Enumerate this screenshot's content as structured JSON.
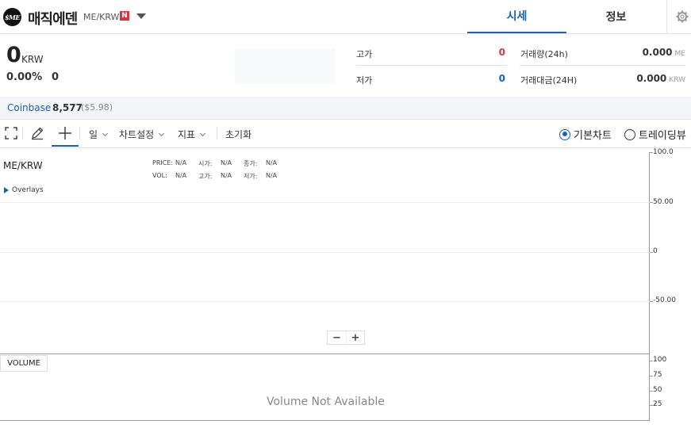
{
  "coin": {
    "logo_text": "$ME",
    "name": "매직에덴",
    "pair": "ME/KRW",
    "badge": "N"
  },
  "tabs": [
    {
      "label": "시세",
      "active": true
    },
    {
      "label": "정보",
      "active": false
    }
  ],
  "price": {
    "value": "0",
    "unit": "KRW",
    "change_rate": "0.00%",
    "change_amount": "0"
  },
  "stats": {
    "high_label": "고가",
    "high_value": "0",
    "low_label": "저가",
    "low_value": "0",
    "volume_label": "거래량(24h)",
    "volume_value": "0.000",
    "volume_unit": "ME",
    "turnover_label": "거래대금(24H)",
    "turnover_value": "0.000",
    "turnover_unit": "KRW"
  },
  "reference": {
    "exchange": "Coinbase",
    "price": "8,577",
    "usd": "($5.98)"
  },
  "toolbar": {
    "interval": "일",
    "chart_settings": "차트설정",
    "indicators": "지표",
    "reset": "초기화",
    "basic_chart": "기본차트",
    "tradingview": "트레이딩뷰",
    "selected_view": "기본차트"
  },
  "chart": {
    "symbol": "ME/KRW",
    "legend": {
      "price_label": "PRICE:",
      "price_value": "N/A",
      "open_label": "시가:",
      "open_value": "N/A",
      "close_label": "종가:",
      "close_value": "N/A",
      "vol_label": "VOL:",
      "vol_value": "N/A",
      "high_label": "고가:",
      "high_value": "N/A",
      "low_label": "저가:",
      "low_value": "N/A"
    },
    "overlays_label": "Overlays",
    "price_axis_ticks": [
      "100.0",
      "50.00",
      "0",
      "-50.00"
    ],
    "volume_label": "VOLUME",
    "volume_axis_ticks": [
      "100",
      "75",
      "50",
      "25"
    ],
    "volume_message": "Volume Not Available"
  },
  "colors": {
    "accent": "#1261c4",
    "high": "#d9353f",
    "low": "#1261c4"
  }
}
